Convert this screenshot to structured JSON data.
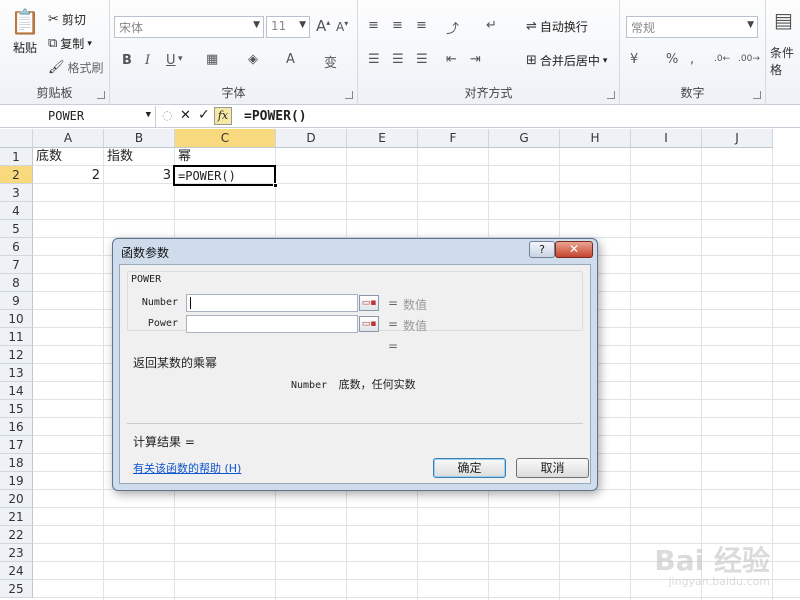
{
  "ribbon": {
    "clipboard": {
      "label": "剪贴板",
      "paste": "粘贴",
      "cut": "剪切",
      "copy": "复制",
      "format_painter": "格式刷"
    },
    "font": {
      "label": "字体",
      "font_name": "宋体",
      "font_size": "11",
      "bold": "B",
      "italic": "I",
      "underline": "U"
    },
    "alignment": {
      "label": "对齐方式",
      "wrap_text": "自动换行",
      "merge_center": "合并后居中"
    },
    "number": {
      "label": "数字",
      "format": "常规",
      "percent": "%",
      "comma": ","
    },
    "styles": {
      "conditional": "条件格"
    }
  },
  "formula_bar": {
    "name_box": "POWER",
    "formula": "=POWER()"
  },
  "columns": [
    "A",
    "B",
    "C",
    "D",
    "E",
    "F",
    "G",
    "H",
    "I",
    "J"
  ],
  "rows": [
    "1",
    "2",
    "3",
    "4",
    "5",
    "6",
    "7",
    "8",
    "9",
    "10",
    "11",
    "12",
    "13",
    "14",
    "15",
    "16",
    "17",
    "18",
    "19",
    "20",
    "21",
    "22",
    "23",
    "24",
    "25"
  ],
  "cells": {
    "A1": "底数",
    "B1": "指数",
    "C1": "幂",
    "A2": "2",
    "B2": "3",
    "C2": "=POWER()"
  },
  "dialog": {
    "title": "函数参数",
    "help_btn": "?",
    "close_btn": "✕",
    "function_name": "POWER",
    "args": [
      {
        "label": "Number",
        "value": "",
        "eq": "=",
        "result": "数值"
      },
      {
        "label": "Power",
        "value": "",
        "eq": "=",
        "result": "数值"
      }
    ],
    "overall_eq": "=",
    "description": "返回某数的乘幂",
    "arg_desc_name": "Number",
    "arg_desc_text": "底数，任何实数",
    "result_label": "计算结果 =",
    "help_link": "有关该函数的帮助 (H)",
    "ok": "确定",
    "cancel": "取消"
  },
  "watermark": {
    "main": "Bai 经验",
    "sub": "jingyan.baidu.com"
  }
}
